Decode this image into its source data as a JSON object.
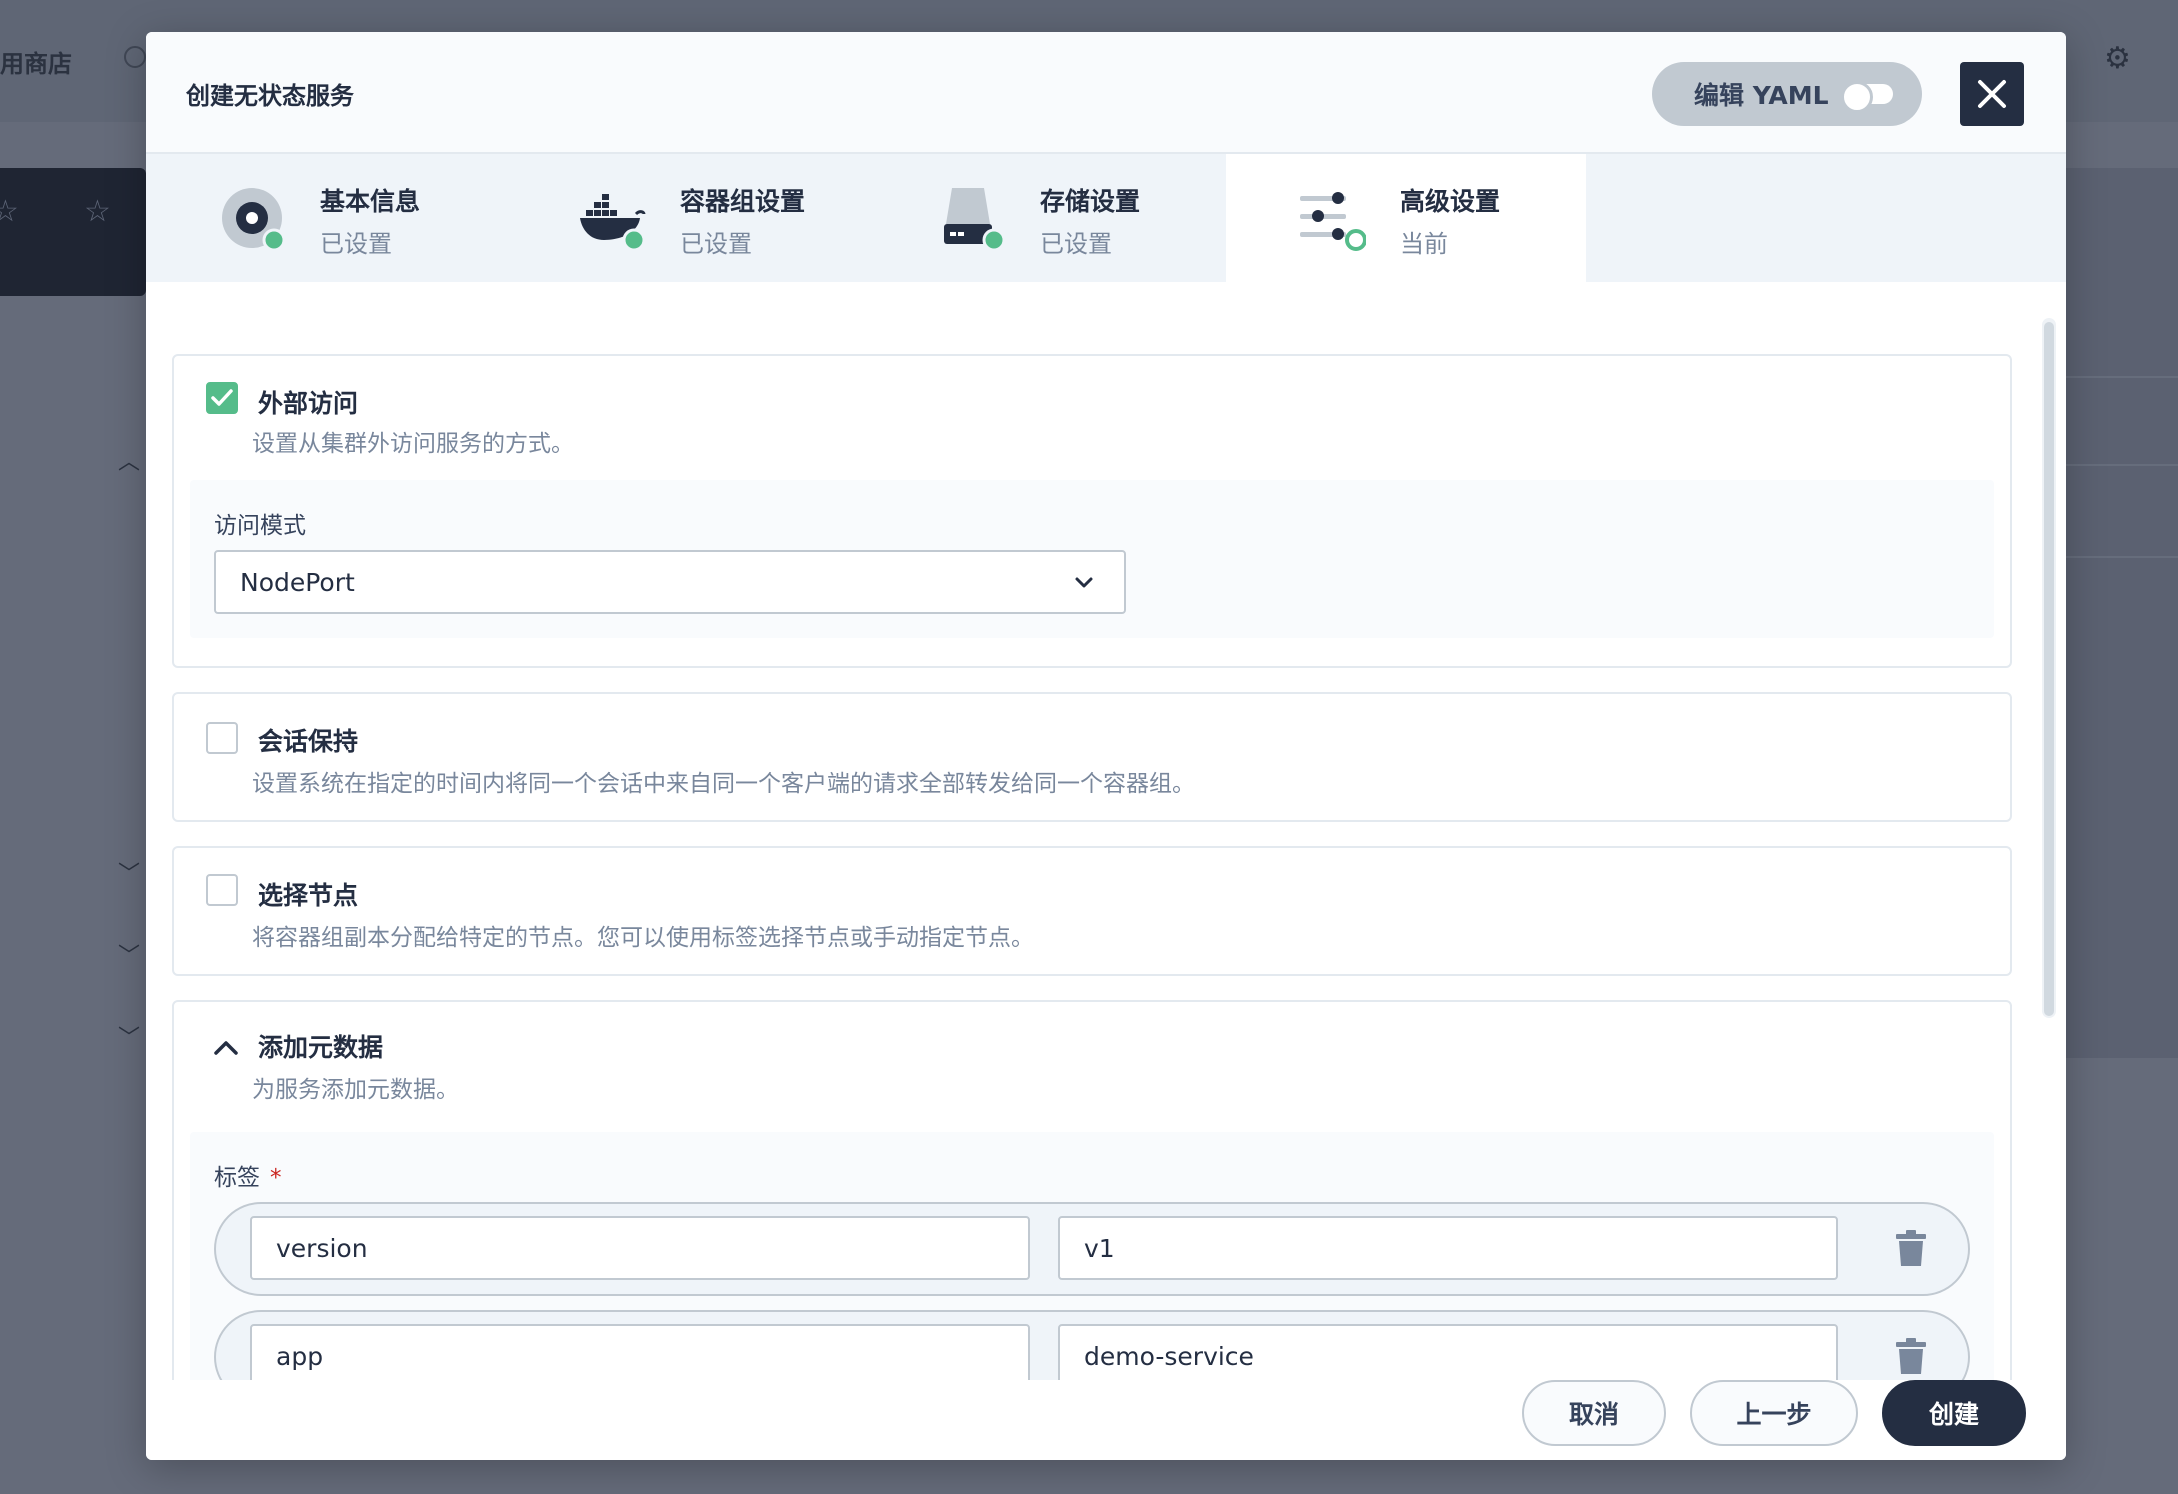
{
  "background": {
    "app_store_label": "用商店"
  },
  "modal": {
    "title": "创建无状态服务",
    "yaml_toggle_label": "编辑 YAML",
    "yaml_toggle_on": false
  },
  "steps": [
    {
      "title": "基本信息",
      "status": "已设置",
      "icon": "disc-icon",
      "done": true
    },
    {
      "title": "容器组设置",
      "status": "已设置",
      "icon": "docker-whale-icon",
      "done": true
    },
    {
      "title": "存储设置",
      "status": "已设置",
      "icon": "hard-drive-icon",
      "done": true
    },
    {
      "title": "高级设置",
      "status": "当前",
      "icon": "sliders-icon",
      "done": false
    }
  ],
  "external_access": {
    "checked": true,
    "title": "外部访问",
    "desc": "设置从集群外访问服务的方式。",
    "mode_label": "访问模式",
    "mode_value": "NodePort"
  },
  "session_affinity": {
    "checked": false,
    "title": "会话保持",
    "desc": "设置系统在指定的时间内将同一个会话中来自同一个客户端的请求全部转发给同一个容器组。"
  },
  "node_selector": {
    "checked": false,
    "title": "选择节点",
    "desc": "将容器组副本分配给特定的节点。您可以使用标签选择节点或手动指定节点。"
  },
  "metadata": {
    "expanded": true,
    "title": "添加元数据",
    "desc": "为服务添加元数据。",
    "labels_label": "标签",
    "required_mark": "*",
    "labels": [
      {
        "key": "version",
        "value": "v1"
      },
      {
        "key": "app",
        "value": "demo-service"
      }
    ]
  },
  "footer": {
    "cancel": "取消",
    "previous": "上一步",
    "create": "创建"
  },
  "colors": {
    "primary": "#242e42",
    "success": "#55bc8a",
    "muted": "#79879c",
    "border": "#c1c9d1",
    "danger": "#ca2621"
  }
}
